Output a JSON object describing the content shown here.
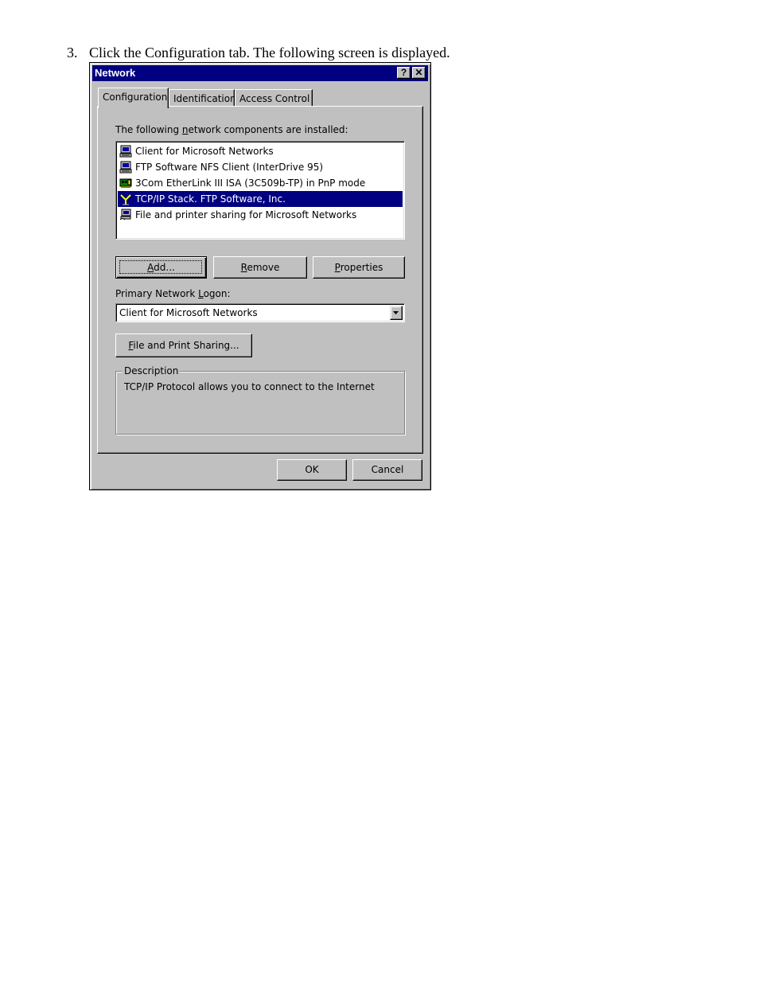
{
  "instruction": {
    "number": "3.",
    "text": "Click the Configuration tab. The following screen is displayed."
  },
  "window": {
    "title": "Network",
    "help_glyph": "?",
    "close_glyph": "✕"
  },
  "tabs": [
    {
      "label": "Configuration",
      "active": true
    },
    {
      "label": "Identification",
      "active": false
    },
    {
      "label": "Access Control",
      "active": false
    }
  ],
  "components": {
    "label_prefix": "The following ",
    "label_underline": "n",
    "label_suffix": "etwork components are installed:",
    "items": [
      {
        "label": "Client for Microsoft Networks",
        "icon": "computer-icon"
      },
      {
        "label": "FTP Software NFS Client (InterDrive 95)",
        "icon": "computer-icon"
      },
      {
        "label": "3Com EtherLink III ISA (3C509b-TP) in PnP mode",
        "icon": "network-card-icon"
      },
      {
        "label": "TCP/IP Stack. FTP Software, Inc.",
        "icon": "protocol-icon",
        "selected": true
      },
      {
        "label": "File and printer sharing for Microsoft Networks",
        "icon": "file-sharing-icon"
      }
    ]
  },
  "buttons": {
    "add": {
      "underline": "A",
      "rest": "dd..."
    },
    "remove": {
      "underline": "R",
      "rest": "emove"
    },
    "properties": {
      "underline": "P",
      "rest": "roperties"
    },
    "file_print": {
      "underline": "F",
      "rest": "ile and Print Sharing..."
    },
    "ok": "OK",
    "cancel": "Cancel"
  },
  "logon": {
    "label_prefix": "Primary Network ",
    "label_underline": "L",
    "label_suffix": "ogon:",
    "value": "Client for Microsoft Networks"
  },
  "description": {
    "legend": "Description",
    "text": "TCP/IP Protocol allows you to connect to the Internet"
  },
  "colors": {
    "titlebar": "#000080",
    "face": "#c0c0c0",
    "selection": "#000080"
  }
}
